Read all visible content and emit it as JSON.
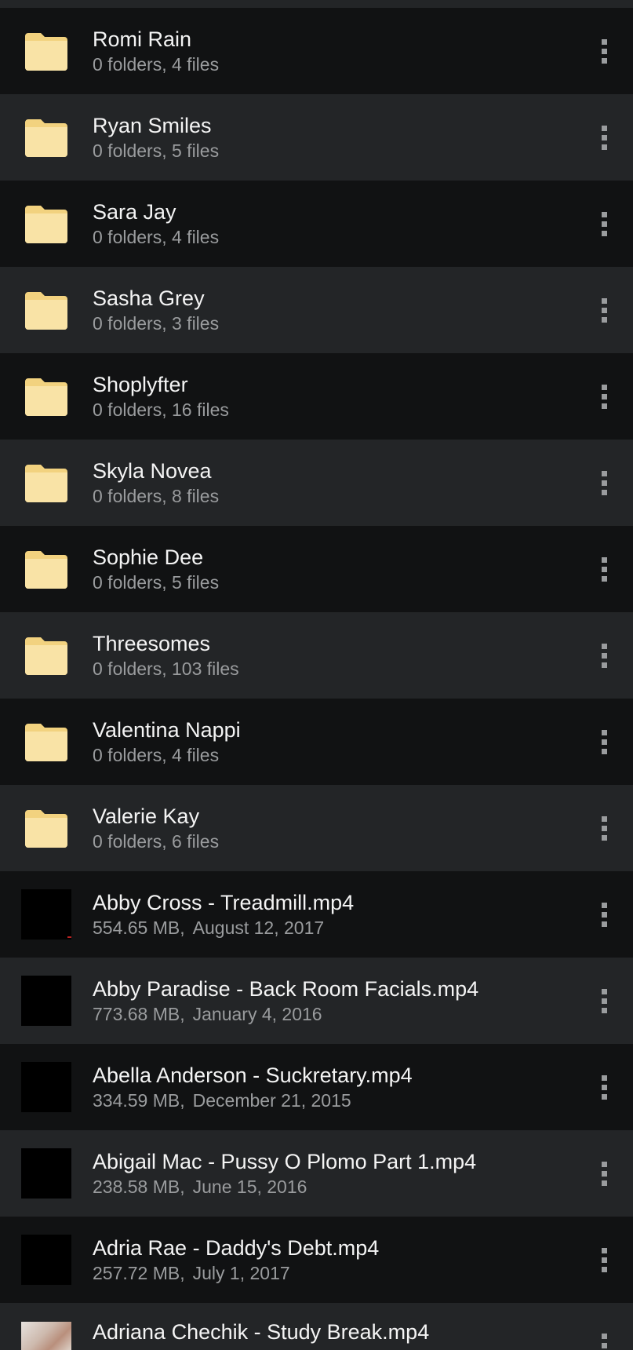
{
  "folders": [
    {
      "name": "Romi Rain",
      "meta": "0 folders, 4 files"
    },
    {
      "name": "Ryan Smiles",
      "meta": "0 folders, 5 files"
    },
    {
      "name": "Sara Jay",
      "meta": "0 folders, 4 files"
    },
    {
      "name": "Sasha Grey",
      "meta": "0 folders, 3 files"
    },
    {
      "name": "Shoplyfter",
      "meta": "0 folders, 16 files"
    },
    {
      "name": "Skyla Novea",
      "meta": "0 folders, 8 files"
    },
    {
      "name": "Sophie Dee",
      "meta": "0 folders, 5 files"
    },
    {
      "name": "Threesomes",
      "meta": "0 folders, 103 files"
    },
    {
      "name": "Valentina Nappi",
      "meta": "0 folders, 4 files"
    },
    {
      "name": "Valerie Kay",
      "meta": "0 folders, 6 files"
    }
  ],
  "files": [
    {
      "name": "Abby Cross - Treadmill.mp4",
      "size": "554.65 MB,",
      "date": "August 12, 2017"
    },
    {
      "name": "Abby Paradise - Back Room Facials.mp4",
      "size": "773.68 MB,",
      "date": "January 4, 2016"
    },
    {
      "name": "Abella Anderson - Suckretary.mp4",
      "size": "334.59 MB,",
      "date": "December 21, 2015"
    },
    {
      "name": "Abigail Mac - Pussy O Plomo Part 1.mp4",
      "size": "238.58 MB,",
      "date": "June 15, 2016"
    },
    {
      "name": "Adria Rae - Daddy's Debt.mp4",
      "size": "257.72 MB,",
      "date": "July 1, 2017"
    },
    {
      "name": "Adriana Chechik - Study Break.mp4",
      "size": "",
      "date": ""
    }
  ],
  "icons": {
    "folder": "folder-icon",
    "more": "more-vertical-icon",
    "video": "video-thumbnail"
  },
  "colors": {
    "folder": "#f9e3a6",
    "folder_tab": "#f2d27f",
    "row_dark": "#111213",
    "row_light": "#232527",
    "title": "#f4f4f4",
    "subtitle": "#9a9c9e"
  }
}
